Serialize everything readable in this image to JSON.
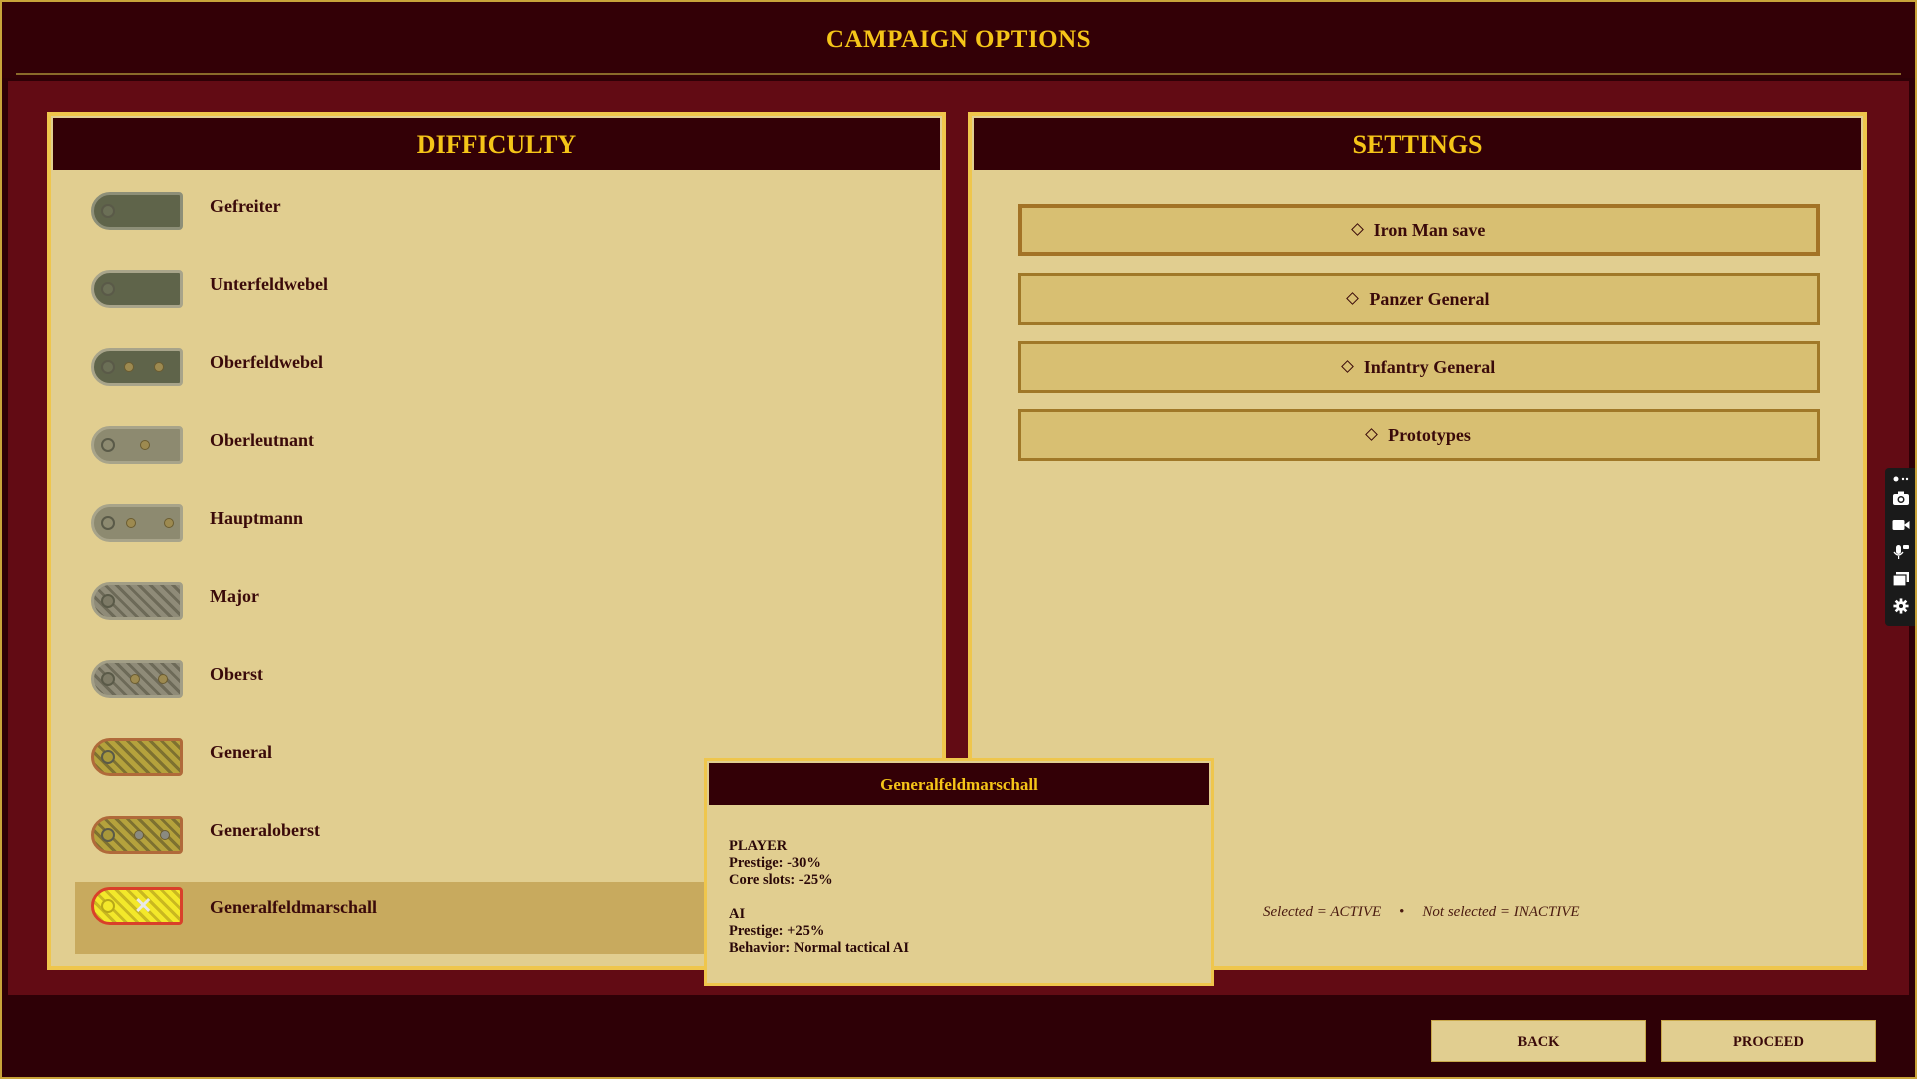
{
  "header": {
    "title": "CAMPAIGN OPTIONS"
  },
  "difficulty": {
    "title": "DIFFICULTY",
    "ranks": [
      {
        "label": "Gefreiter"
      },
      {
        "label": "Unterfeldwebel"
      },
      {
        "label": "Oberfeldwebel"
      },
      {
        "label": "Oberleutnant"
      },
      {
        "label": "Hauptmann"
      },
      {
        "label": "Major"
      },
      {
        "label": "Oberst"
      },
      {
        "label": "General"
      },
      {
        "label": "Generaloberst"
      },
      {
        "label": "Generalfeldmarschall"
      }
    ],
    "selected": "Generalfeldmarschall"
  },
  "settings": {
    "title": "SETTINGS",
    "options": [
      {
        "label": "Iron Man save"
      },
      {
        "label": "Panzer General"
      },
      {
        "label": "Infantry General"
      },
      {
        "label": "Prototypes"
      }
    ],
    "legend_active": "Selected = ACTIVE",
    "legend_separator": "•",
    "legend_inactive": "Not selected = INACTIVE"
  },
  "tooltip": {
    "title": "Generalfeldmarschall",
    "player_header": "PLAYER",
    "player_prestige": "Prestige: -30%",
    "player_core_slots": "Core slots: -25%",
    "ai_header": "AI",
    "ai_prestige": "Prestige: +25%",
    "ai_behavior": "Behavior: Normal tactical AI"
  },
  "footer": {
    "back_label": "BACK",
    "proceed_label": "PROCEED"
  },
  "icons": [
    "camera-icon",
    "video-icon",
    "microphone-icon",
    "window-icon",
    "gear-icon"
  ],
  "colors": {
    "accent_gold": "#f5c518",
    "panel_bg": "#e1ce90",
    "frame_red": "#620b14",
    "dark_maroon": "#330006"
  }
}
